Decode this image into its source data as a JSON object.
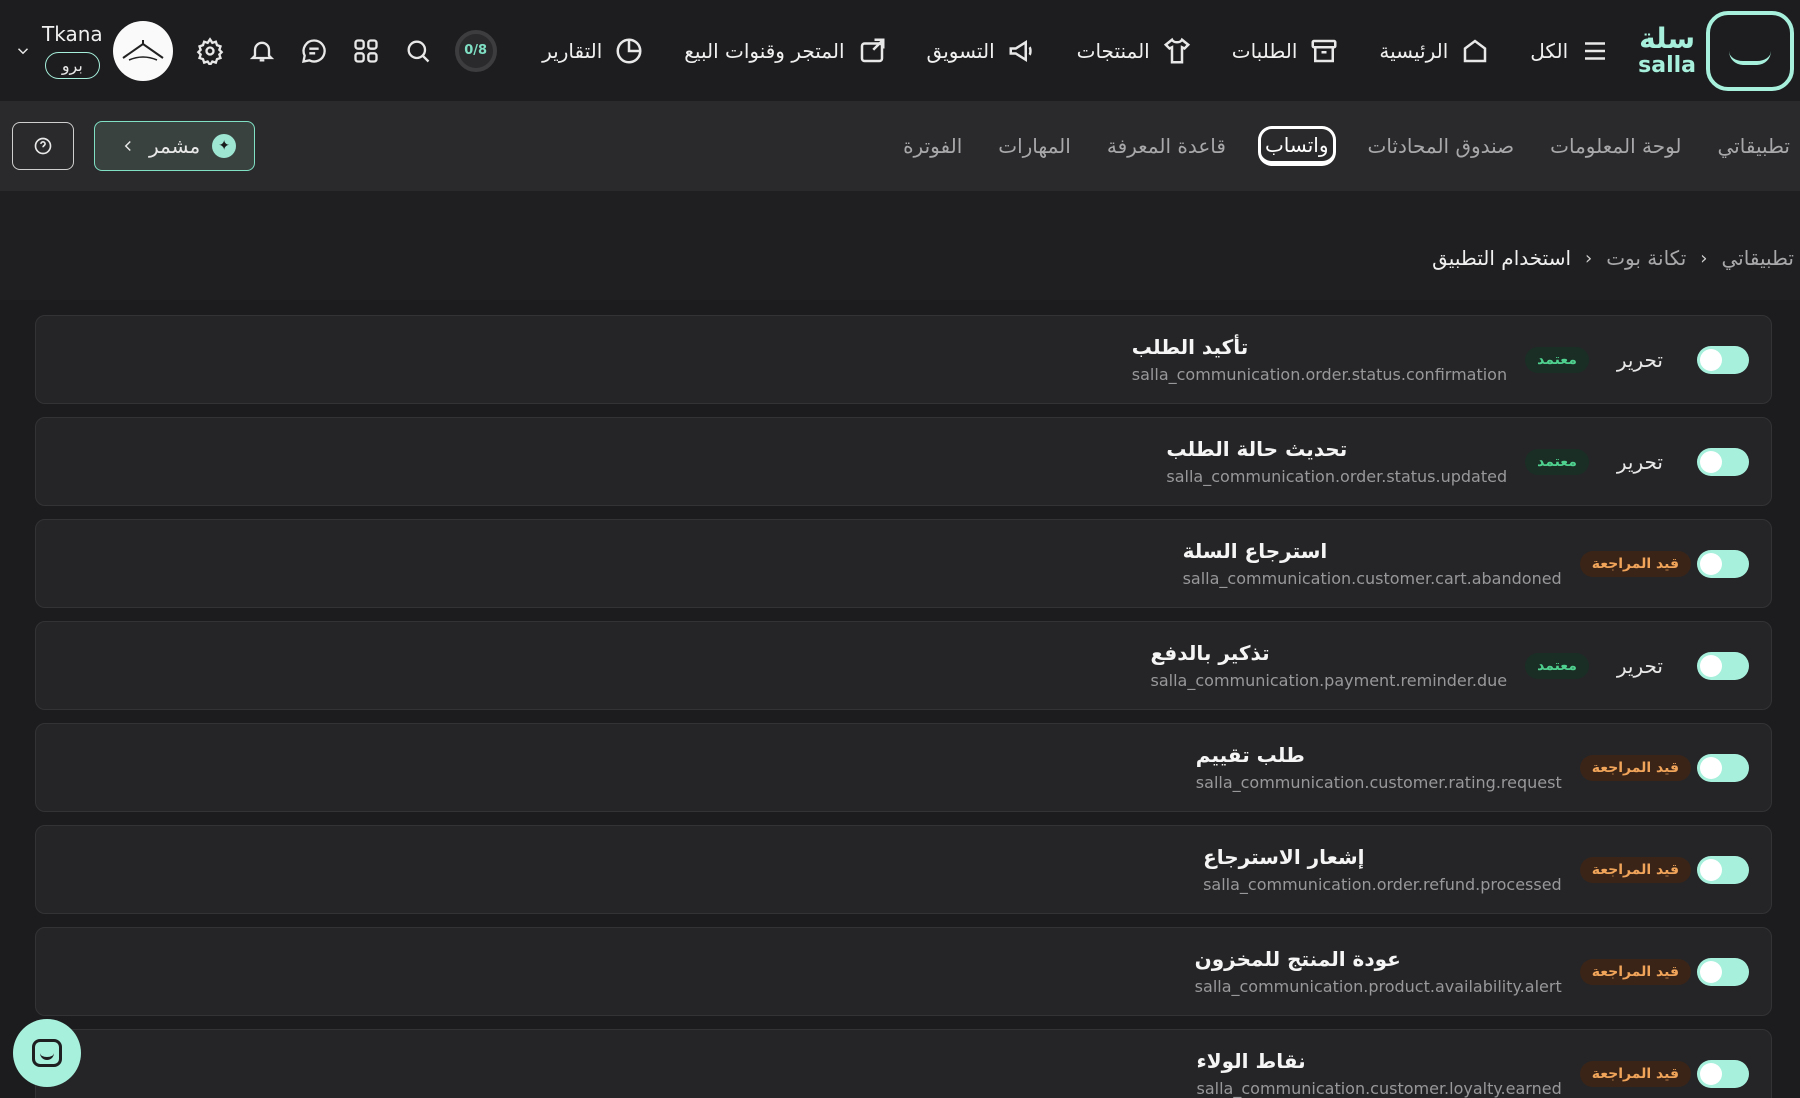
{
  "topnav": {
    "logo_ar": "سلة",
    "logo_en": "salla",
    "items": [
      {
        "label": "الكل",
        "icon": "menu-icon"
      },
      {
        "label": "الرئيسية",
        "icon": "home-icon"
      },
      {
        "label": "الطلبات",
        "icon": "archive-box-icon"
      },
      {
        "label": "المنتجات",
        "icon": "tshirt-icon"
      },
      {
        "label": "التسويق",
        "icon": "megaphone-icon"
      },
      {
        "label": "المتجر وقنوات البيع",
        "icon": "store-share-icon"
      },
      {
        "label": "التقارير",
        "icon": "pie-chart-icon"
      }
    ],
    "progress": "0/8",
    "profile_name": "Tkana",
    "plan": "برو"
  },
  "subnav": {
    "tabs": [
      "تطبيقاتي",
      "لوحة المعلومات",
      "صندوق المحادثات",
      "واتساب",
      "قاعدة المعرفة",
      "المهارات",
      "الفوترة"
    ],
    "active_tab": "واتساب",
    "mushmer_label": "مشمر"
  },
  "breadcrumb": [
    "تطبيقاتي",
    "تكانة بوت",
    "استخدام التطبيق"
  ],
  "templates": {
    "edit_label": "تحرير",
    "rows": [
      {
        "title": "تأكيد الطلب",
        "key": "salla_communication.order.status.confirmation",
        "status": "معتمد",
        "enabled": true
      },
      {
        "title": "تحديث حالة الطلب",
        "key": "salla_communication.order.status.updated",
        "status": "معتمد",
        "enabled": true
      },
      {
        "title": "استرجاع السلة",
        "key": "salla_communication.customer.cart.abandoned",
        "status": "قيد المراجعة",
        "enabled": true
      },
      {
        "title": "تذكير بالدفع",
        "key": "salla_communication.payment.reminder.due",
        "status": "معتمد",
        "enabled": true
      },
      {
        "title": "طلب تقييم",
        "key": "salla_communication.customer.rating.request",
        "status": "قيد المراجعة",
        "enabled": true
      },
      {
        "title": "إشعار الاسترجاع",
        "key": "salla_communication.order.refund.processed",
        "status": "قيد المراجعة",
        "enabled": true
      },
      {
        "title": "عودة المنتج للمخزون",
        "key": "salla_communication.product.availability.alert",
        "status": "قيد المراجعة",
        "enabled": true
      },
      {
        "title": "نقاط الولاء",
        "key": "salla_communication.customer.loyalty.earned",
        "status": "قيد المراجعة",
        "enabled": true
      }
    ]
  },
  "colors": {
    "accent": "#a7f0dc",
    "approved": "#4fd08e",
    "pending": "#f0a45a"
  }
}
